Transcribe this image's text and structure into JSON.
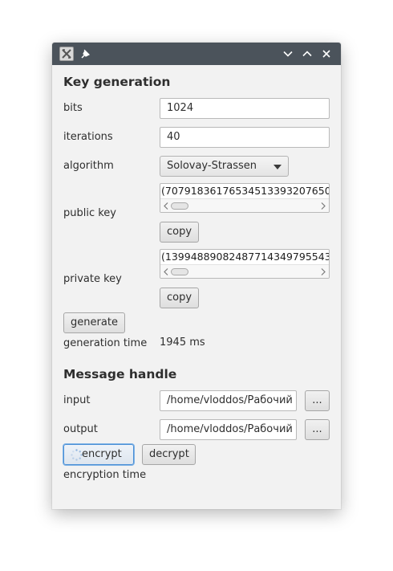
{
  "window": {
    "titlebar_controls": [
      "chevron-down-icon",
      "chevron-up-icon",
      "close-icon"
    ]
  },
  "key_generation": {
    "title": "Key generation",
    "bits_label": "bits",
    "bits_value": "1024",
    "iterations_label": "iterations",
    "iterations_value": "40",
    "algorithm_label": "algorithm",
    "algorithm_value": "Solovay-Strassen",
    "public_key_label": "public key",
    "public_key_value": "(70791836176534513393207650",
    "public_copy_label": "copy",
    "private_key_label": "private key",
    "private_key_value": "(13994889082487714349795543",
    "private_copy_label": "copy",
    "generate_label": "generate",
    "generation_time_label": "generation time",
    "generation_time_value": "1945 ms"
  },
  "message_handle": {
    "title": "Message handle",
    "input_label": "input",
    "input_value": "/home/vloddos/Рабочий",
    "input_browse_label": "...",
    "output_label": "output",
    "output_value": "/home/vloddos/Рабочий",
    "output_browse_label": "...",
    "encrypt_label": "encrypt",
    "decrypt_label": "decrypt",
    "encryption_time_label": "encryption time"
  },
  "colors": {
    "titlebar": "#4b535b",
    "window_bg": "#f2f2f2",
    "focus_ring": "#4a8fd6"
  }
}
